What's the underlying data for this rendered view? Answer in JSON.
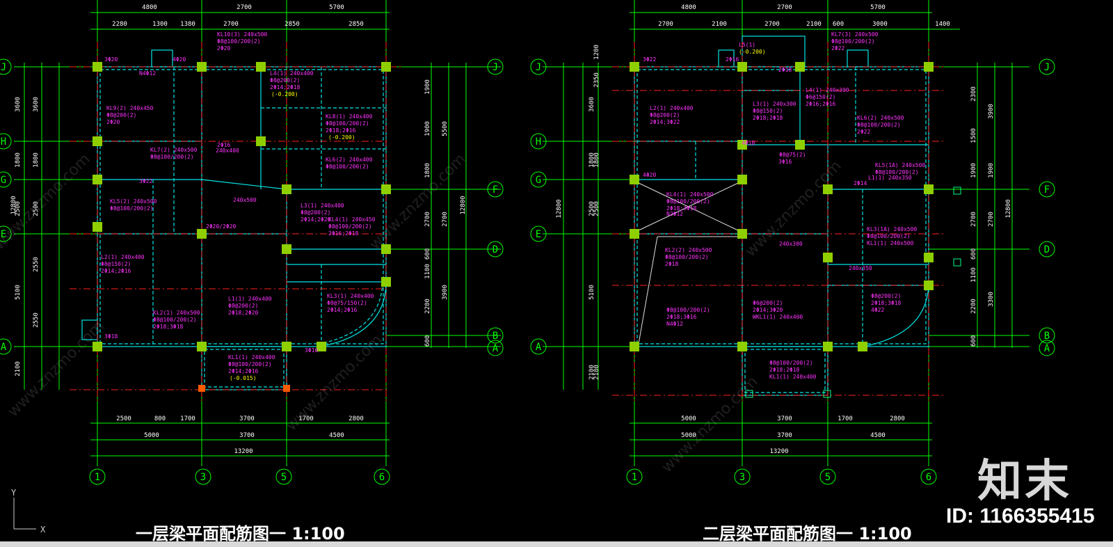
{
  "drawings": [
    {
      "title": "一层梁平面配筋图一   1:100",
      "top_dims_row1": [
        "4800",
        "2700",
        "5700"
      ],
      "top_dims_row2": [
        "2280",
        "1300",
        "1380",
        "2700",
        "2850",
        "2850"
      ],
      "bottom_dims_row1": [
        "2500",
        "800",
        "1700",
        "3700",
        "1700",
        "2800"
      ],
      "bottom_dims_row2": [
        "5000",
        "3700",
        "4500"
      ],
      "bottom_total": "13200",
      "axes_bottom": [
        "1",
        "3",
        "5",
        "6"
      ],
      "axes_left": [
        "J",
        "H",
        "G",
        "E",
        "A"
      ],
      "axes_right": [
        "J",
        "F",
        "D",
        "B",
        "A"
      ],
      "left_dims_outer": [
        "3600",
        "1800",
        "2500",
        "5100",
        "2100"
      ],
      "left_dims_inner": [
        "3600",
        "1800",
        "2500",
        "2550",
        "2550"
      ],
      "left_total": "12800",
      "right_dims_inner": [
        "1900",
        "1900",
        "1800",
        "2700",
        "600",
        "1100",
        "2200",
        "600"
      ],
      "right_dims_outer": [
        "5500",
        "2700",
        "3900"
      ],
      "right_total": "12800",
      "beam_labels": [
        "KL10(3) 240x500",
        "Φ8@100/200(2)",
        "2Φ20",
        "KL9(2) 240x450",
        "Φ8@200(2)",
        "2Φ20",
        "L4(1) 240x400",
        "Φ8@200(2)",
        "2Φ14;2Φ18",
        "(-0.200)",
        "KL8(1) 240x400",
        "Φ8@100/200(2)",
        "2Φ18;2Φ16",
        "(-0.200)",
        "KL7(2) 240x500",
        "Φ8@100/200(2)",
        "KL6(2) 240x400",
        "Φ8@100/200(2)",
        "KL5(2) 240x500",
        "Φ8@100/200(2)",
        "L3(1) 240x400",
        "Φ8@200(2)",
        "2Φ14;2Φ20",
        "KL4(1) 240x450",
        "Φ8@100/200(2)",
        "2Φ16;2Φ18",
        "L2(1) 240x400",
        "Φ8@150(2)",
        "2Φ14;2Φ16",
        "L1(1) 240x400",
        "Φ8@200(2)",
        "2Φ18;2Φ20",
        "KL2(1) 240x500",
        "Φ8@100/200(2)",
        "2Φ18;3Φ18",
        "KL3(1) 240x400",
        "Φ8@75/150(2)",
        "2Φ14;2Φ16",
        "KL1(1) 240x400",
        "Φ8@100/200(2)",
        "2Φ14;2Φ16",
        "(-0.015)",
        "3Φ20",
        "4Φ20",
        "3Φ18",
        "N4Φ12",
        "2Φ16",
        "240x400",
        "3Φ22",
        "240x500",
        "2Φ20/2Φ20",
        "3Φ16",
        "Φ8@100(2)"
      ]
    },
    {
      "title": "二层梁平面配筋图一   1:100",
      "top_dims_row1": [
        "4800",
        "2700",
        "5700"
      ],
      "top_dims_row2": [
        "2700",
        "2100",
        "2700",
        "2100",
        "600",
        "3000",
        "1400"
      ],
      "bottom_dims_row1": [
        "5000",
        "3700",
        "1700",
        "2800"
      ],
      "bottom_dims_row2": [
        "5000",
        "3700",
        "4500"
      ],
      "bottom_total": "13200",
      "axes_bottom": [
        "1",
        "3",
        "5",
        "6"
      ],
      "axes_left": [
        "J",
        "H",
        "G",
        "E",
        "A"
      ],
      "axes_right": [
        "J",
        "F",
        "D",
        "B",
        "A"
      ],
      "left_dims_outer": [
        "3600",
        "1800",
        "2500",
        "5100",
        "2100"
      ],
      "left_dims_inner": [
        "1200",
        "2350",
        "1800",
        "2500",
        "2100"
      ],
      "left_total": "12800",
      "right_dims_inner": [
        "2300",
        "1500",
        "1900",
        "2700",
        "600",
        "1100",
        "2200",
        "600"
      ],
      "right_dims_outer": [
        "3900",
        "1900",
        "2700",
        "3300"
      ],
      "right_total": "12800",
      "beam_labels": [
        "L5(1)",
        "(-0.200)",
        "KL7(3) 240x500",
        "Φ8@100/200(2)",
        "2Φ22",
        "L2(1) 240x400",
        "Φ8@200(2)",
        "2Φ14;3Φ22",
        "L4(1) 240x300",
        "Φ6@150(2)",
        "2Φ16;2Φ16",
        "L3(1) 240x300",
        "Φ8@150(2)",
        "2Φ18;2Φ18",
        "KL6(2) 240x500",
        "Φ8@100/200(2)",
        "2Φ22",
        "KL5(1A) 240x500",
        "Φ8@100/200(2)",
        "KL4(1) 240x500",
        "Φ8@100/200(2)",
        "2Φ18;3Φ18",
        "N2Φ12",
        "KL2(2) 240x500",
        "Φ8@100/200(2)",
        "2Φ18",
        "KL3(1A) 240x500",
        "Φ8@100/200(2)",
        "KL1(1) 240x500",
        "Φ8@100/200(2)",
        "2Φ18;3Φ16",
        "N4Φ12",
        "L1(1) 240x350",
        "Φ6@200(2)",
        "2Φ14;3Φ20",
        "WKL1(1) 240x400",
        "Φ8@100/200(2)",
        "2Φ18;2Φ18",
        "KL1(1) 240x400",
        "Φ8@200(2)",
        "2Φ18;3Φ18",
        "4Φ22",
        "3Φ22",
        "2Φ16",
        "240x350",
        "2Φ18",
        "240x300",
        "Φ8@75(2)",
        "3Φ16",
        "4Φ18",
        "4Φ20",
        "2Φ14"
      ]
    }
  ],
  "ucs": {
    "y_label": "Y",
    "x_label": "X"
  },
  "watermark": {
    "logo_text": "知末",
    "id_text": "ID: 1166355415",
    "diagonal_text": "www.znzmo.com"
  },
  "colors": {
    "background": "#000000",
    "axis": "#00ff00",
    "beam": "#00e5e5",
    "label": "#ff33ff",
    "dim": "#ffffff",
    "column": "#8fcf00",
    "elev": "#ffff00",
    "red": "#ff2020"
  }
}
